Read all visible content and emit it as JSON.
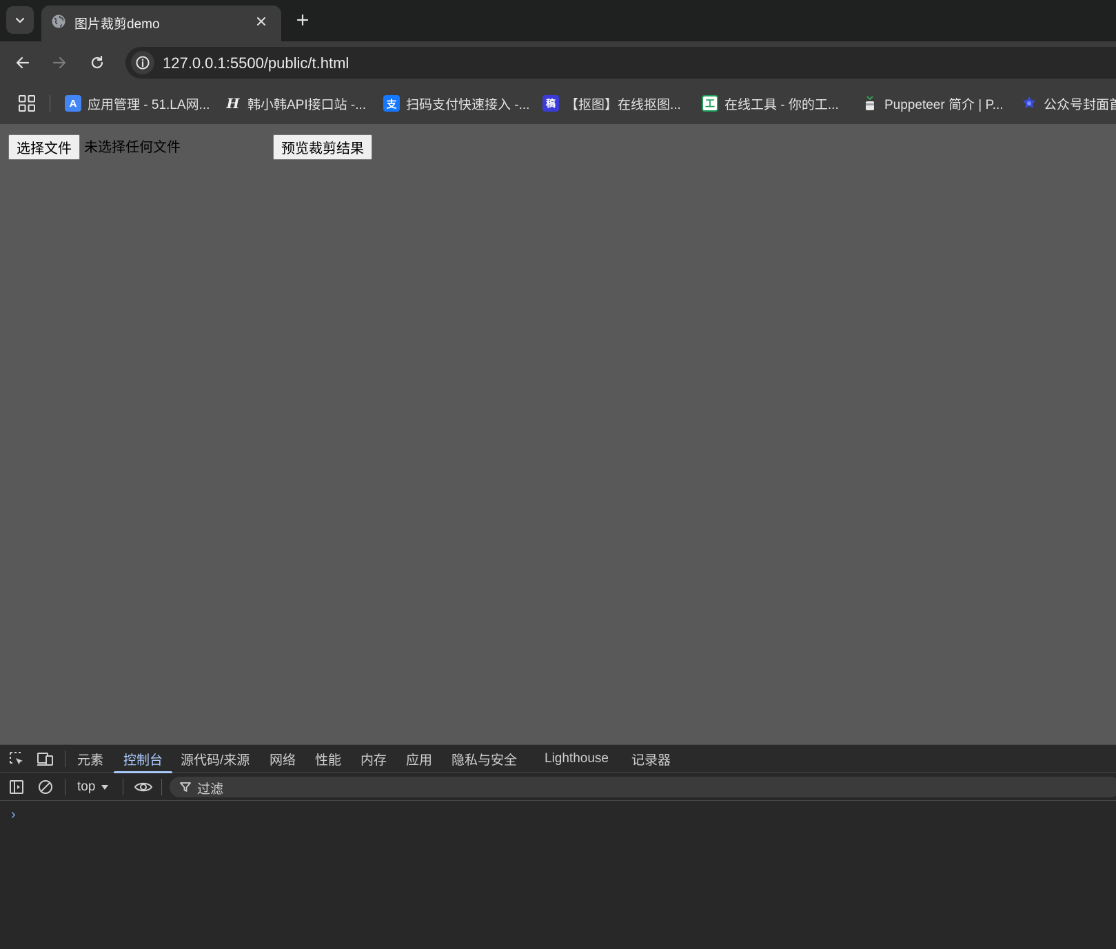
{
  "browser": {
    "tab": {
      "title": "图片裁剪demo",
      "favicon": "globe-icon"
    },
    "address": {
      "url": "127.0.0.1:5500/public/t.html"
    },
    "bookmarks": [
      {
        "label": "应用管理 - 51.LA网...",
        "icon": "51la-icon",
        "color": "#4285f4"
      },
      {
        "label": "韩小韩API接口站 -...",
        "icon": "hanxiaohan-icon",
        "color": "#111111"
      },
      {
        "label": "扫码支付快速接入 -...",
        "icon": "alipay-icon",
        "color": "#1677ff"
      },
      {
        "label": "【抠图】在线抠图...",
        "icon": "koutu-icon",
        "color": "#3b3bd8"
      },
      {
        "label": "在线工具 - 你的工...",
        "icon": "tools-icon",
        "color": "#1e9e5a"
      },
      {
        "label": "Puppeteer 简介 | P...",
        "icon": "puppeteer-icon",
        "color": "#2ea44f"
      },
      {
        "label": "公众号封面首",
        "icon": "cover-icon",
        "color": "#3a4bd8"
      }
    ]
  },
  "page": {
    "file_button": "选择文件",
    "file_status": "未选择任何文件",
    "preview_button": "预览裁剪结果"
  },
  "devtools": {
    "tabs": [
      "元素",
      "控制台",
      "源代码/来源",
      "网络",
      "性能",
      "内存",
      "应用",
      "隐私与安全",
      "Lighthouse",
      "记录器"
    ],
    "active_tab": "控制台",
    "context": "top",
    "filter_placeholder": "过滤",
    "prompt": "›"
  }
}
